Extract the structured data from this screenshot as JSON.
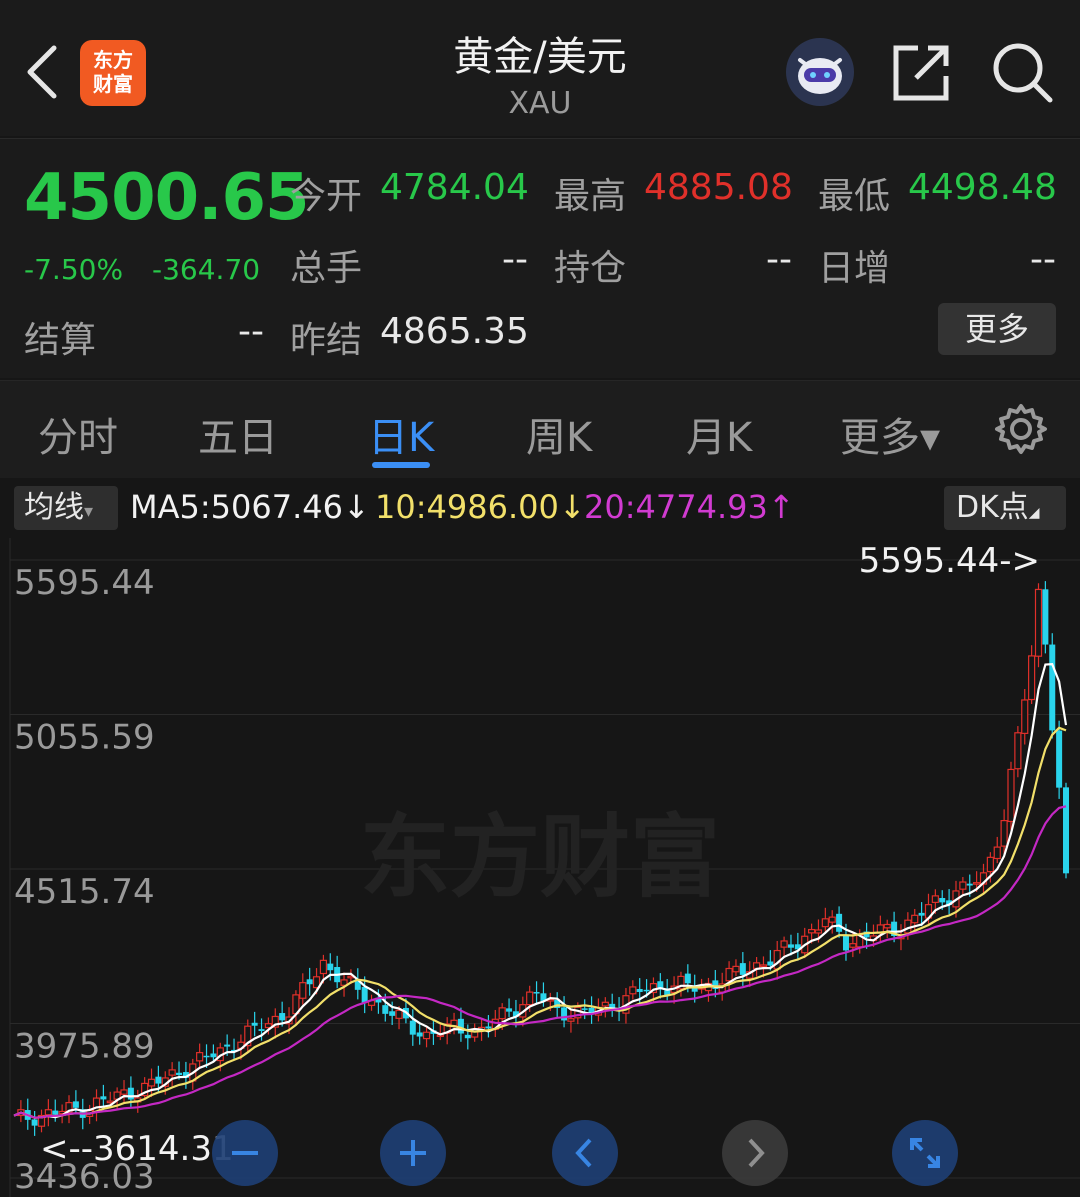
{
  "header": {
    "title": "黄金/美元",
    "subtitle": "XAU",
    "logo_text": "东方\n财富"
  },
  "quote": {
    "price": "4500.65",
    "change_pct": "-7.50%",
    "change": "-364.70",
    "open_label": "今开",
    "open": "4784.04",
    "high_label": "最高",
    "high": "4885.08",
    "low_label": "最低",
    "low": "4498.48",
    "volume_label": "总手",
    "volume": "--",
    "position_label": "持仓",
    "position": "--",
    "daily_inc_label": "日增",
    "daily_inc": "--",
    "settle_label": "结算",
    "settle": "--",
    "prev_settle_label": "昨结",
    "prev_settle": "4865.35",
    "more_label": "更多"
  },
  "tabs": [
    {
      "label": "分时"
    },
    {
      "label": "五日"
    },
    {
      "label": "日K"
    },
    {
      "label": "周K"
    },
    {
      "label": "月K"
    },
    {
      "label": "更多▾"
    }
  ],
  "ma_bar": {
    "select_label": "均线",
    "ma5": "MA5:5067.46↓",
    "ma10": "10:4986.00↓",
    "ma20": "20:4774.93↑",
    "dk_label": "DK点"
  },
  "chart_data": {
    "type": "candlestick",
    "y_ticks": [
      "5595.44",
      "5055.59",
      "4515.74",
      "3975.89",
      "3436.03"
    ],
    "ylim": [
      3436.03,
      5595.44
    ],
    "max_marker": "5595.44->",
    "min_marker": "<--3614.31",
    "watermark": "东方财富",
    "colors": {
      "up": "#e0302a",
      "down": "#2ad4ec",
      "ma5": "#ffffff",
      "ma10": "#f2e06a",
      "ma20": "#c428c4"
    }
  },
  "colors": {
    "up": "#e0302a",
    "down": "#28c84a",
    "accent": "#3b8ff5"
  }
}
